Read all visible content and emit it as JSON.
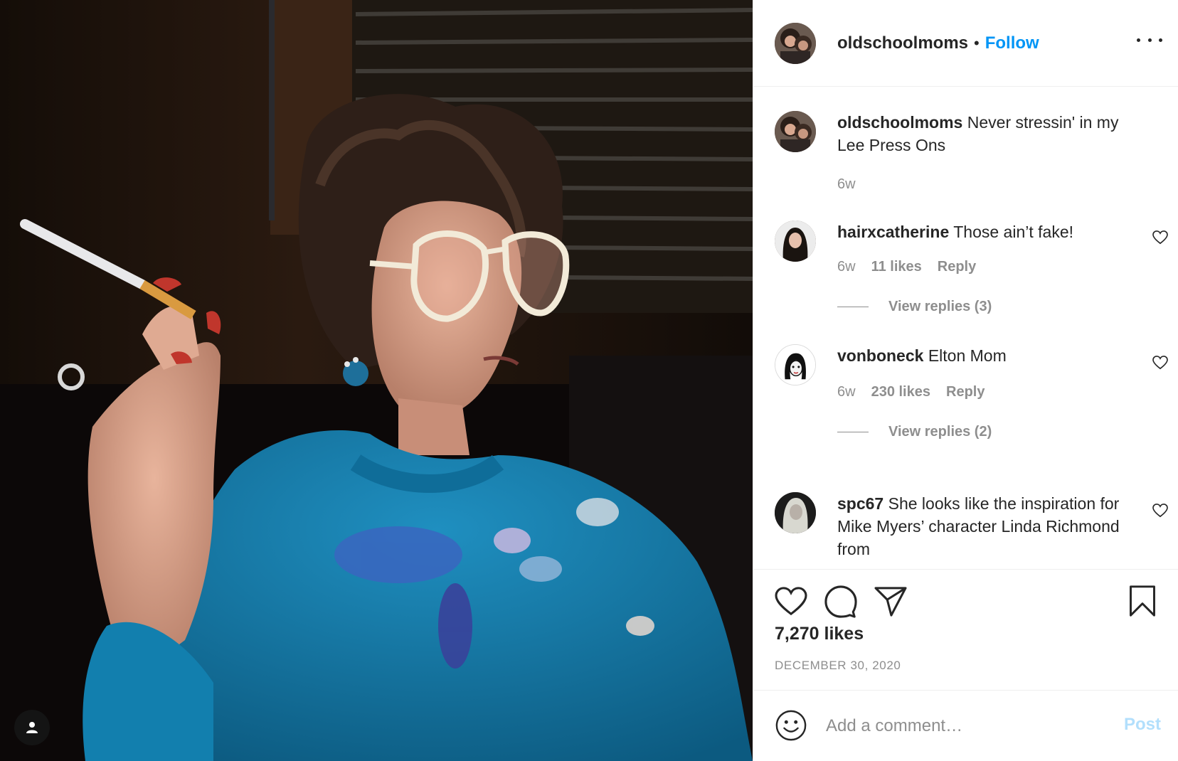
{
  "post": {
    "author": "oldschoolmoms",
    "follow_label": "Follow",
    "separator": "•",
    "caption": "Never stressin' in my Lee Press Ons",
    "caption_age": "6w"
  },
  "comments": [
    {
      "username": "hairxcatherine",
      "text": "Those ain’t fake!",
      "age": "6w",
      "likes": "11 likes",
      "reply_label": "Reply",
      "view_replies": "View replies (3)"
    },
    {
      "username": "vonboneck",
      "text": "Elton Mom",
      "age": "6w",
      "likes": "230 likes",
      "reply_label": "Reply",
      "view_replies": "View replies (2)"
    },
    {
      "username": "spc67",
      "text": "She looks like the inspiration for Mike Myers’ character Linda Richmond from"
    }
  ],
  "stats": {
    "likes": "7,270 likes",
    "date": "DECEMBER 30, 2020"
  },
  "composer": {
    "placeholder": "Add a comment…",
    "post_label": "Post"
  },
  "icons": [
    "tag-user-icon",
    "more-options-icon",
    "heart-icon",
    "comment-icon",
    "share-icon",
    "bookmark-icon",
    "emoji-icon"
  ],
  "colors": {
    "link_blue": "#0095f6",
    "post_disabled": "#b2dffc",
    "secondary_text": "#8e8e8e"
  }
}
